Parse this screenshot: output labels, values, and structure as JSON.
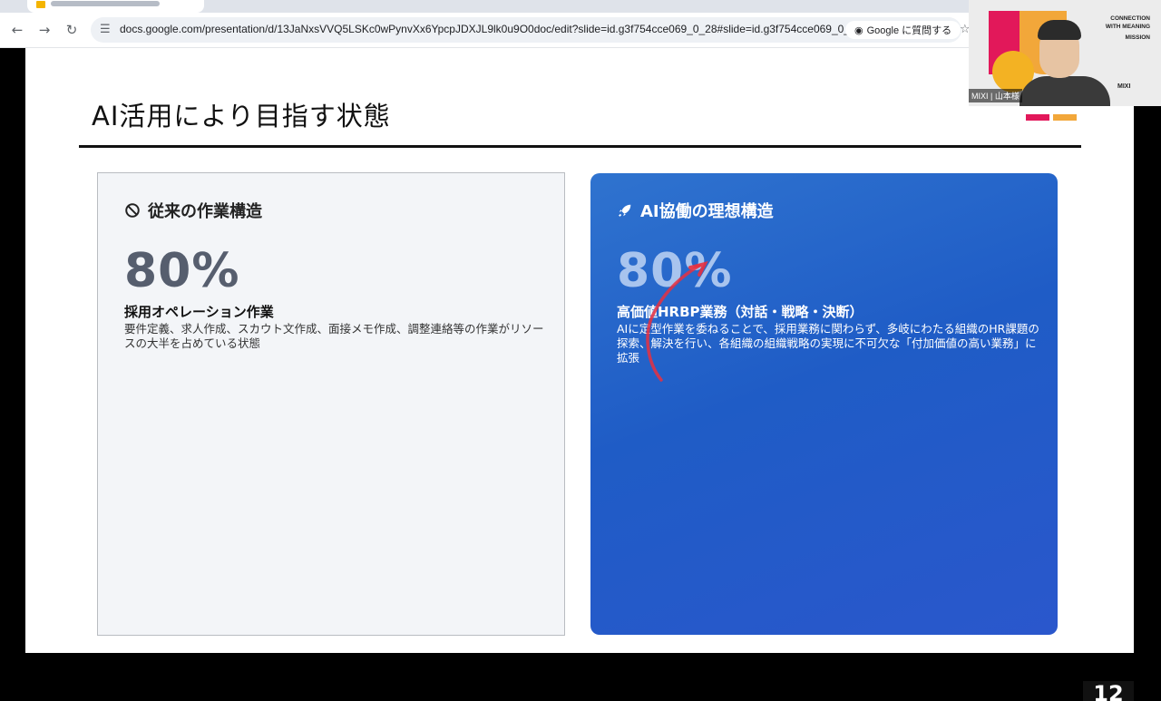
{
  "browser": {
    "url": "docs.google.com/presentation/d/13JaNxsVVQ5LSKc0wPynvXx6YpcpJDXJL9lk0u9O0doc/edit?slide=id.g3f754cce069_0_28#slide=id.g3f754cce069_0_28",
    "ask_google_label": "Google に質問する"
  },
  "slide": {
    "title": "AI活用により目指す状態",
    "left_card": {
      "heading": "従来の作業構造",
      "percent": "80%",
      "subheading": "採用オペレーション作業",
      "description": "要件定義、求人作成、スカウト文作成、面接メモ作成、調整連絡等の作業がリソースの大半を占めている状態"
    },
    "right_card": {
      "heading": "AI協働の理想構造",
      "percent": "80%",
      "subheading": "高価値HRBP業務（対話・戦略・決断）",
      "description": "AIに定型作業を委ねることで、採用業務に関わらず、多岐にわたる組織のHR課題の探索、解決を行い、各組織の組織戦略の実現に不可欠な「付加価値の高い業務」に拡張"
    },
    "page_number": "12"
  },
  "webcam": {
    "brand_line1": "CONNECTION",
    "brand_line2": "WITH MEANING",
    "brand_line3": "MISSION",
    "mixi_label": "MIXI",
    "name_tag": "MIXI | 山本様"
  },
  "colors": {
    "accent_red": "#e2185a",
    "accent_orange": "#f2a73a",
    "card_blue": "#2a62cc",
    "annotation_red": "#e8303f"
  },
  "icons": {
    "left_card_heading": "prohibited-icon",
    "right_card_heading": "rocket-icon"
  }
}
